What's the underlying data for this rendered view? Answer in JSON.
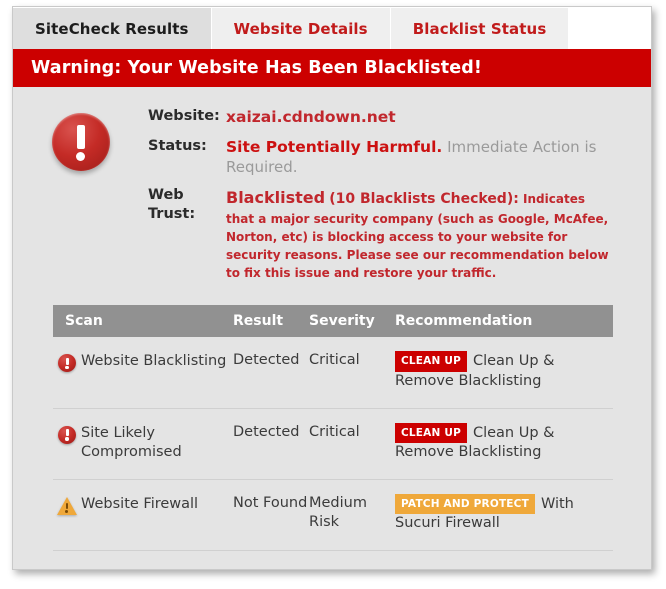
{
  "tabs": [
    {
      "label": "SiteCheck Results",
      "active": true
    },
    {
      "label": "Website Details",
      "active": false
    },
    {
      "label": "Blacklist Status",
      "active": false
    }
  ],
  "banner": {
    "text": "Warning: Your Website Has Been Blacklisted!",
    "color": "#cc0000"
  },
  "summary": {
    "alert_icon": "exclamation-circle-icon",
    "website_label": "Website:",
    "website_value": "xaizai.cdndown.net",
    "status_label": "Status:",
    "status_strong": "Site Potentially Harmful.",
    "status_muted": "Immediate Action is Required.",
    "trust_label": "Web Trust:",
    "trust_headline": "Blacklisted",
    "trust_count": "(10 Blacklists Checked):",
    "trust_body": "Indicates that a major security company (such as Google, McAfee, Norton, etc) is blocking access to your website for security reasons. Please see our recommendation below to fix this issue and restore your traffic."
  },
  "table": {
    "headers": {
      "scan": "Scan",
      "result": "Result",
      "severity": "Severity",
      "recommendation": "Recommendation"
    },
    "rows": [
      {
        "icon": "exclamation-circle-icon",
        "scan": "Website Blacklisting",
        "result": "Detected",
        "severity": "Critical",
        "badge": "CLEAN UP",
        "badge_color": "#cc0000",
        "recommendation": "Clean Up & Remove Blacklisting"
      },
      {
        "icon": "exclamation-circle-icon",
        "scan": "Site Likely Compromised",
        "result": "Detected",
        "severity": "Critical",
        "badge": "CLEAN UP",
        "badge_color": "#cc0000",
        "recommendation": "Clean Up & Remove Blacklisting"
      },
      {
        "icon": "warning-triangle-icon",
        "scan": "Website Firewall",
        "result": "Not Found",
        "severity": "Medium Risk",
        "badge": "PATCH AND PROTECT",
        "badge_color": "#efa83a",
        "recommendation": "With Sucuri Firewall"
      }
    ]
  }
}
